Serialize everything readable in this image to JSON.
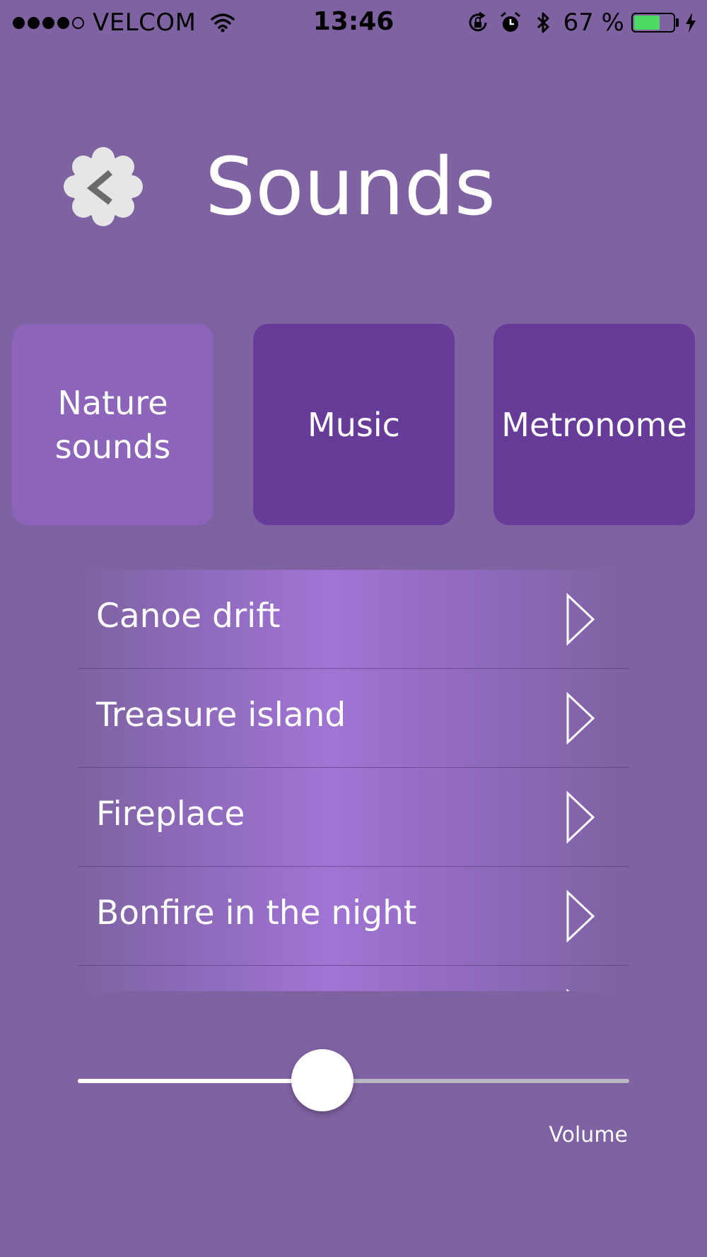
{
  "status_bar": {
    "signal_filled": 4,
    "signal_total": 5,
    "carrier": "VELCOM",
    "time": "13:46",
    "battery_text": "67 %",
    "battery_level": 0.67,
    "icons": [
      "wifi-icon",
      "rotation-lock-icon",
      "alarm-icon",
      "bluetooth-icon",
      "charging-icon"
    ]
  },
  "header": {
    "back_icon": "back-arrow-icon",
    "title": "Sounds"
  },
  "tabs": [
    {
      "line1": "Nature",
      "line2": "sounds",
      "active": true
    },
    {
      "line1": "Music",
      "line2": "",
      "active": false
    },
    {
      "line1": "Metronome",
      "line2": "",
      "active": false
    }
  ],
  "sounds": [
    {
      "label": "Canoe drift"
    },
    {
      "label": "Treasure island"
    },
    {
      "label": "Fireplace"
    },
    {
      "label": "Bonfire in the night"
    }
  ],
  "volume": {
    "label": "Volume",
    "level": 0.444
  },
  "colors": {
    "background": "#7e62a1",
    "tab_active": "#8c64b9",
    "tab_inactive": "#673c99",
    "battery_fill": "#4cd964"
  }
}
